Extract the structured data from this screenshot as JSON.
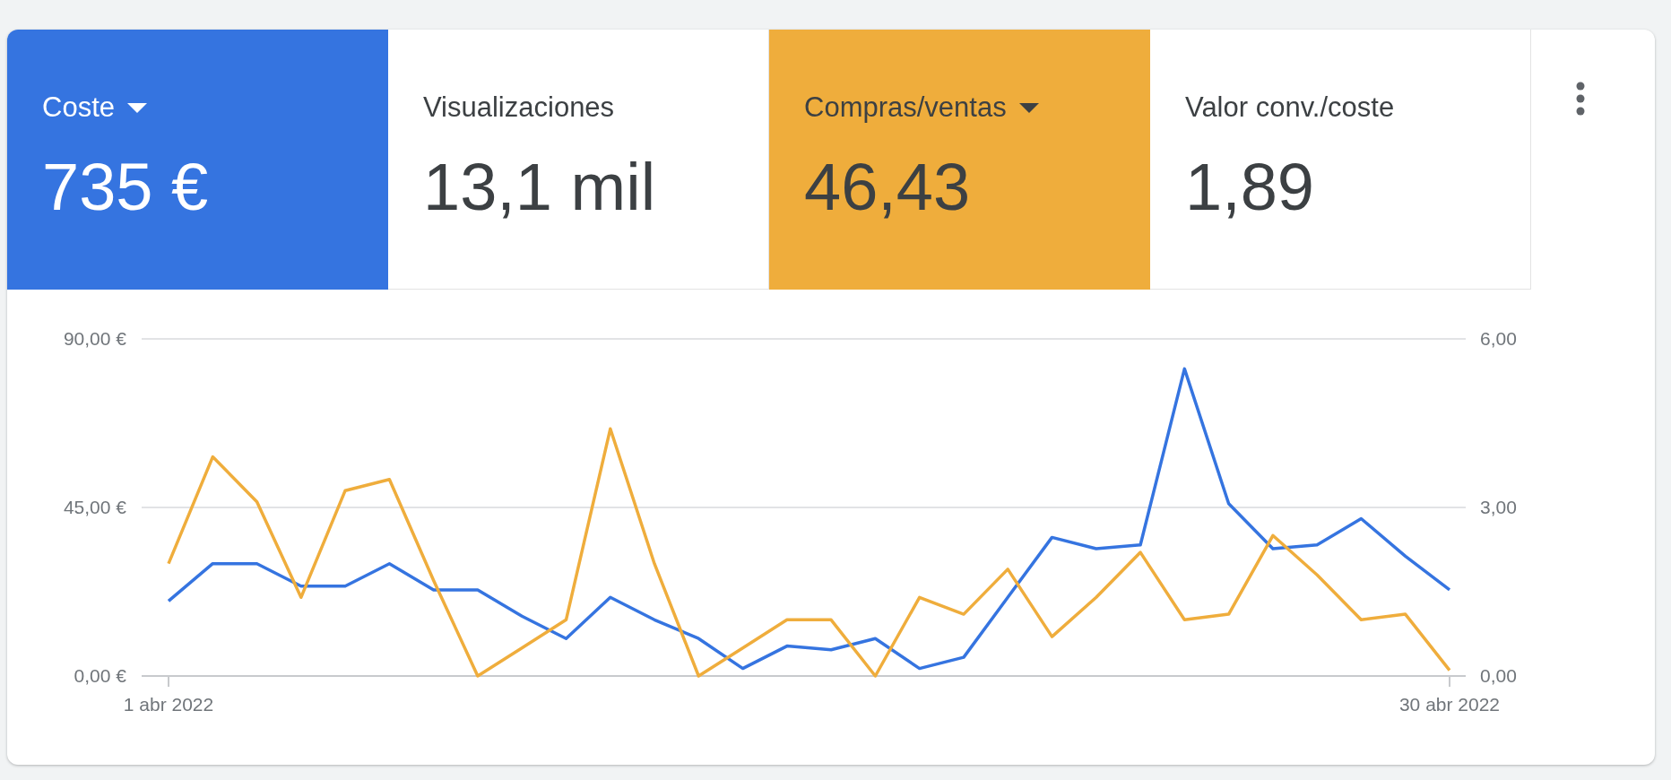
{
  "metrics": [
    {
      "label": "Coste",
      "value": "735 €",
      "selected": true,
      "color": "#3574e0"
    },
    {
      "label": "Visualizaciones",
      "value": "13,1 mil",
      "selected": false,
      "color": "#ffffff"
    },
    {
      "label": "Compras/ventas",
      "value": "46,43",
      "selected": true,
      "color": "#efad3c"
    },
    {
      "label": "Valor conv./coste",
      "value": "1,89",
      "selected": false,
      "color": "#ffffff"
    }
  ],
  "chart": {
    "chart_data": {
      "type": "line",
      "categories": [
        "1 abr 2022",
        null,
        null,
        null,
        null,
        null,
        null,
        null,
        null,
        null,
        null,
        null,
        null,
        null,
        null,
        null,
        null,
        null,
        null,
        null,
        null,
        null,
        null,
        null,
        null,
        null,
        null,
        null,
        null,
        "30 abr 2022"
      ],
      "ylim": [
        0,
        90
      ],
      "yticks": [
        {
          "value": 0,
          "label": "0,00 €"
        },
        {
          "value": 45,
          "label": "45,00 €"
        },
        {
          "value": 90,
          "label": "90,00 €"
        }
      ],
      "y2lim": [
        0,
        6
      ],
      "y2ticks": [
        {
          "value": 0,
          "label": "0,00"
        },
        {
          "value": 3,
          "label": "3,00"
        },
        {
          "value": 6,
          "label": "6,00"
        }
      ],
      "series": [
        {
          "color": "#3574e0",
          "axis": "y",
          "values": [
            20,
            30,
            30,
            24,
            24,
            30,
            23,
            23,
            16,
            10,
            21,
            15,
            10,
            2,
            8,
            7,
            10,
            2,
            5,
            21,
            37,
            34,
            35,
            82,
            46,
            34,
            35,
            42,
            32,
            23
          ]
        },
        {
          "color": "#efad3c",
          "axis": "y2",
          "values": [
            2.0,
            3.9,
            3.1,
            1.4,
            3.3,
            3.5,
            1.7,
            0.0,
            0.5,
            1.0,
            4.4,
            2.0,
            0.0,
            0.5,
            1.0,
            1.0,
            0.0,
            1.4,
            1.1,
            1.9,
            0.7,
            1.4,
            2.2,
            1.0,
            1.1,
            2.5,
            1.8,
            1.0,
            1.1,
            0.1
          ]
        }
      ]
    }
  }
}
